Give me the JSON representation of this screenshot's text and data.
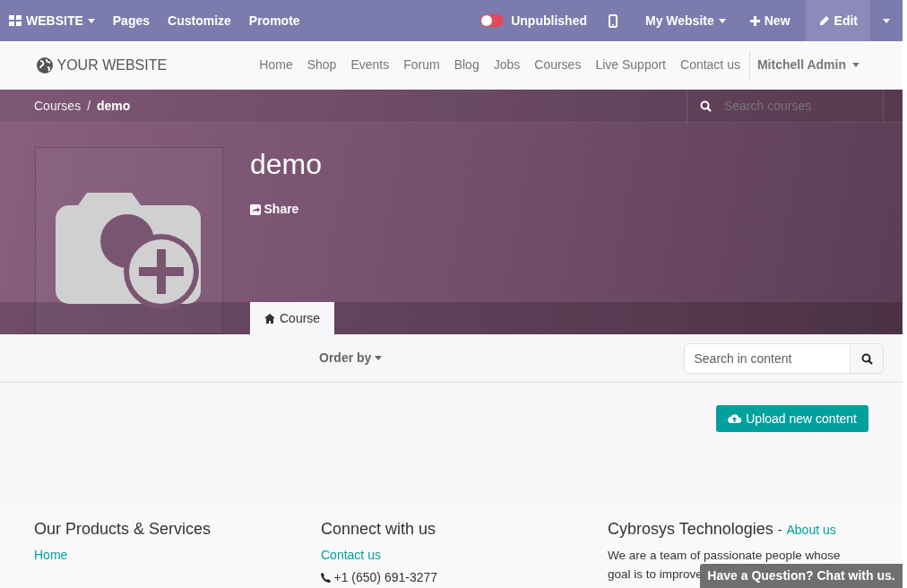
{
  "admin_bar": {
    "app_menu": "WEBSITE",
    "items": [
      "Pages",
      "Customize",
      "Promote"
    ],
    "publish": {
      "label": "Unpublished",
      "on": false
    },
    "website": "My Website",
    "new": "New",
    "edit": "Edit"
  },
  "navbar": {
    "logo": "YOUR WEBSITE",
    "links": [
      "Home",
      "Shop",
      "Events",
      "Forum",
      "Blog",
      "Jobs",
      "Courses",
      "Live Support",
      "Contact us"
    ],
    "user": "Mitchell Admin"
  },
  "breadcrumb": [
    "Courses",
    "demo"
  ],
  "breadcrumb_separator": "/",
  "search_courses": {
    "placeholder": "Search courses"
  },
  "course": {
    "title": "demo",
    "share": "Share"
  },
  "tabs": [
    {
      "label": "Course",
      "selected": true
    }
  ],
  "toolbar": {
    "order_by": "Order by",
    "search": {
      "placeholder": "Search in content"
    }
  },
  "upload_button": "Upload new content",
  "footer": {
    "columns": [
      {
        "title": "Our Products & Services",
        "links": [
          "Home"
        ]
      },
      {
        "title": "Connect with us",
        "links": [
          "Contact us"
        ],
        "phone": "+1 (650) 691-3277"
      },
      {
        "title": "Cybrosys Technologies",
        "title_separator": "-",
        "title_link": "About us",
        "text_lines": [
          "We are a team of passionate people whose",
          "goal is to improve"
        ]
      }
    ]
  },
  "chat_button": "Have a Question? Chat with us."
}
